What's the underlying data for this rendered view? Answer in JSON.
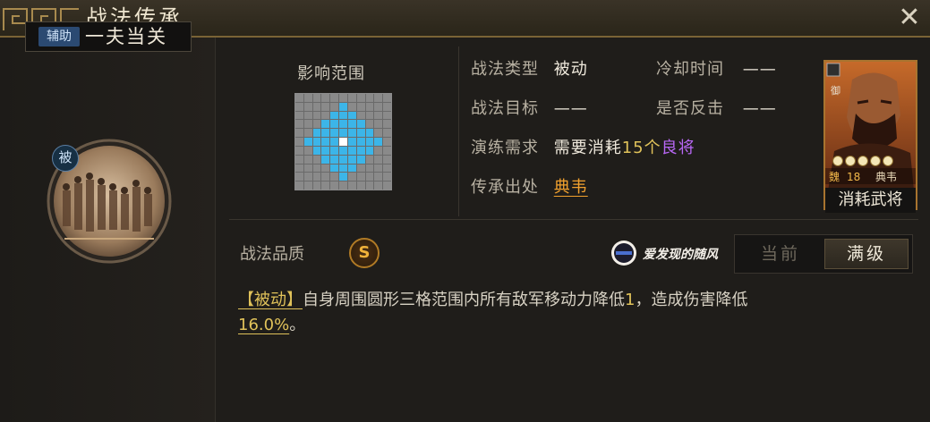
{
  "window": {
    "title": "战法传承"
  },
  "skill": {
    "type_tag": "辅助",
    "name": "一夫当关",
    "passive_badge": "被"
  },
  "range": {
    "label": "影响范围"
  },
  "info": {
    "type_label": "战法类型",
    "type_value": "被动",
    "cooldown_label": "冷却时间",
    "cooldown_value": "——",
    "target_label": "战法目标",
    "target_value": "——",
    "counter_label": "是否反击",
    "counter_value": "——",
    "train_label": "演练需求",
    "train_prefix": "需要消耗",
    "train_count": "15个",
    "train_item": "良将",
    "origin_label": "传承出处",
    "origin_value": "典韦"
  },
  "hero_card": {
    "faction": "魏",
    "level": "18",
    "name": "典韦",
    "rank_tag": "御",
    "stars": 5,
    "consume_label": "消耗武将"
  },
  "quality": {
    "label": "战法品质",
    "grade": "S"
  },
  "watermark": {
    "text": "爱发现的随风"
  },
  "toggle": {
    "current": "当前",
    "max": "满级"
  },
  "description": {
    "tag": "【被动】",
    "part1": "自身周围圆形三格范围内所有敌军移动力降低",
    "value1": "1",
    "part2": "，造成伤害降低",
    "value2": "16.0%",
    "part3": "。"
  },
  "colors": {
    "accent_gold": "#e0c25a",
    "accent_orange": "#f2a12e",
    "accent_purple": "#b867f5",
    "grid_blue": "#3cb5e8"
  }
}
